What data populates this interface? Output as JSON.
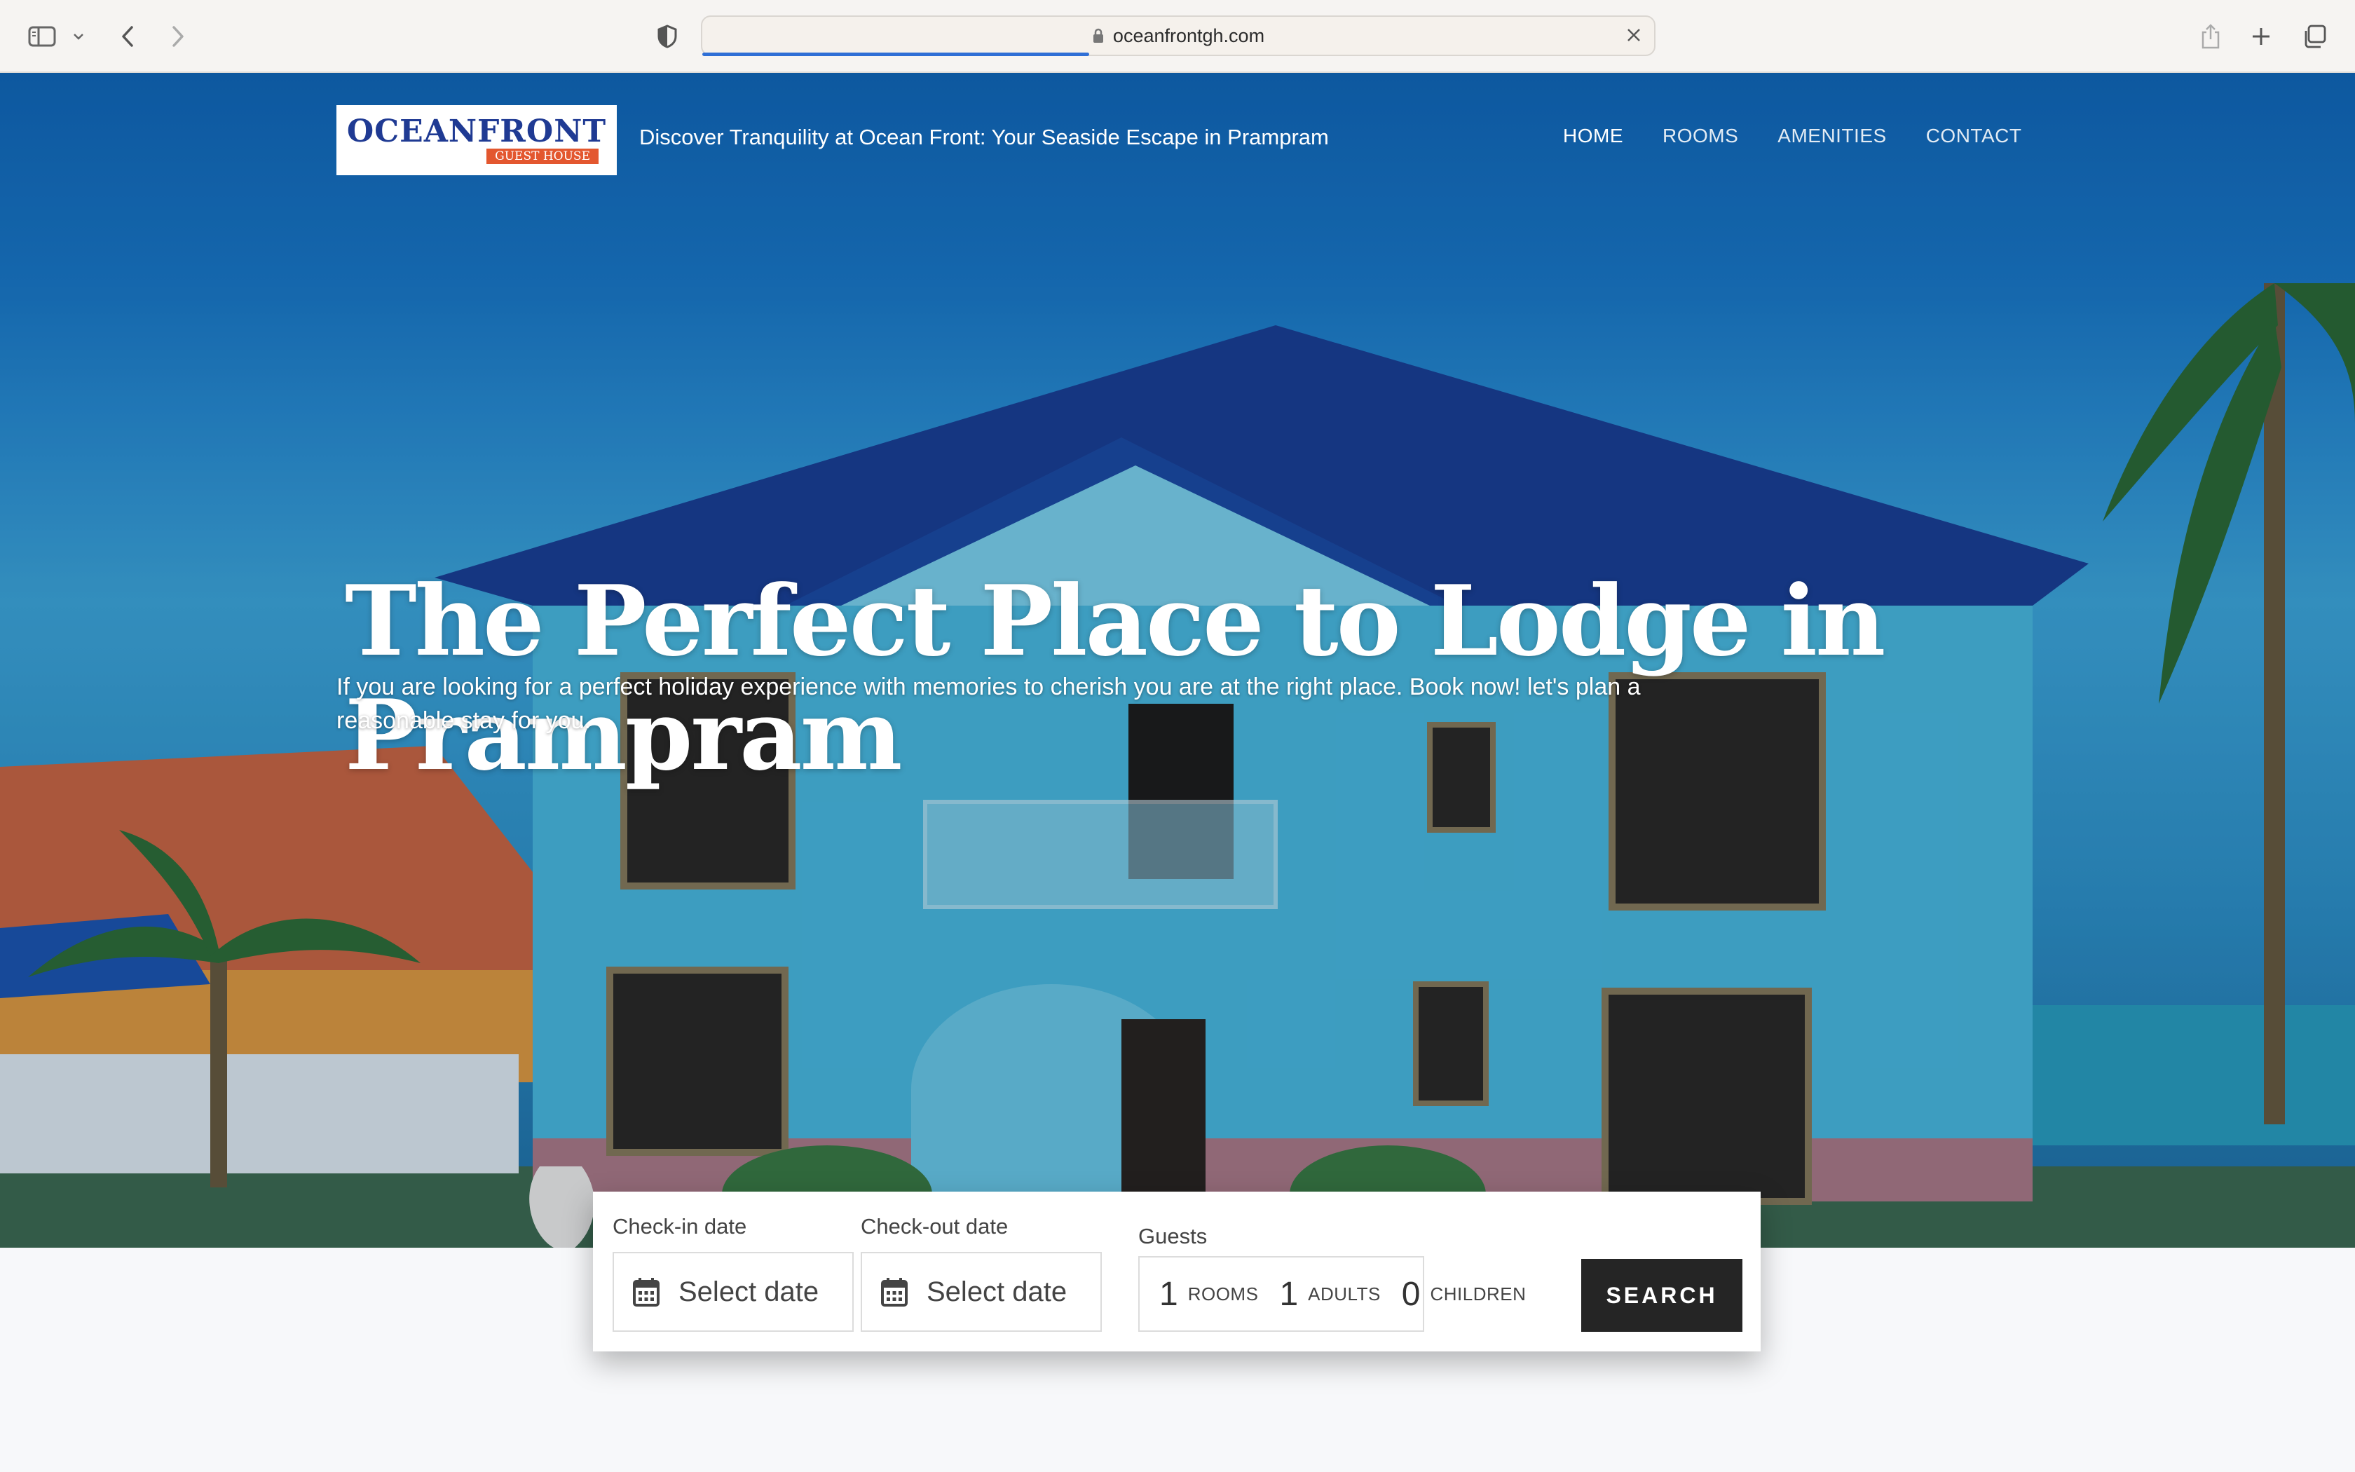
{
  "browser": {
    "url": "oceanfrontgh.com",
    "icons": [
      "sidebar-icon",
      "chevron-down-icon",
      "back-icon",
      "forward-icon",
      "shield-icon",
      "lock-icon",
      "close-icon",
      "share-icon",
      "new-tab-icon",
      "tabs-overview-icon"
    ]
  },
  "header": {
    "logo_word": "OCEANFRONT",
    "logo_sub": "GUEST HOUSE",
    "tagline": "Discover Tranquility at Ocean Front: Your Seaside Escape in Prampram",
    "nav": [
      {
        "label": "HOME"
      },
      {
        "label": "ROOMS"
      },
      {
        "label": "AMENITIES"
      },
      {
        "label": "CONTACT"
      }
    ]
  },
  "hero": {
    "title": "The Perfect Place to Lodge in Prampram",
    "subtitle": "If you are looking for a perfect holiday experience with memories to cherish you are at the right place.  Book now! let's plan a reasonable stay for you."
  },
  "booking": {
    "checkin_label": "Check-in date",
    "checkin_placeholder": "Select date",
    "checkout_label": "Check-out date",
    "checkout_placeholder": "Select date",
    "guests_label": "Guests",
    "rooms_count": "1",
    "rooms_unit": "ROOMS",
    "adults_count": "1",
    "adults_unit": "ADULTS",
    "children_count": "0",
    "children_unit": "CHILDREN",
    "search_label": "SEARCH"
  },
  "colors": {
    "brand_blue": "#1f3a93",
    "brand_orange": "#e3572f",
    "search_button": "#252525"
  }
}
